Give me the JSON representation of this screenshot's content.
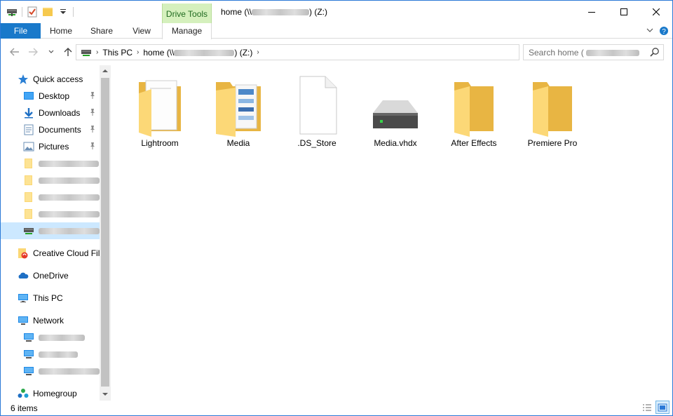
{
  "window": {
    "title": "home (\\\\",
    "title_suffix": ") (Z:)",
    "context_tab_group": "Drive Tools",
    "accent_color": "#1979ca"
  },
  "ribbon": {
    "tabs": [
      {
        "label": "File"
      },
      {
        "label": "Home"
      },
      {
        "label": "Share"
      },
      {
        "label": "View"
      },
      {
        "label": "Manage"
      }
    ]
  },
  "address": {
    "crumbs": [
      {
        "label": "This PC"
      },
      {
        "label": "home (\\\\",
        "suffix": ") (Z:)"
      }
    ]
  },
  "search": {
    "placeholder": "Search home ("
  },
  "nav": {
    "quick_access": "Quick access",
    "pinned": [
      {
        "label": "Desktop",
        "icon": "desktop-icon"
      },
      {
        "label": "Downloads",
        "icon": "downloads-icon"
      },
      {
        "label": "Documents",
        "icon": "documents-icon"
      },
      {
        "label": "Pictures",
        "icon": "pictures-icon"
      }
    ],
    "creative_cloud": "Creative Cloud Fil",
    "onedrive": "OneDrive",
    "this_pc": "This PC",
    "network": "Network",
    "homegroup": "Homegroup"
  },
  "files": [
    {
      "name": "Lightroom",
      "icon": "folder-with-document-icon"
    },
    {
      "name": "Media",
      "icon": "folder-with-pictures-icon"
    },
    {
      "name": ".DS_Store",
      "icon": "blank-file-icon"
    },
    {
      "name": "Media.vhdx",
      "icon": "hard-drive-icon"
    },
    {
      "name": "After Effects",
      "icon": "folder-icon"
    },
    {
      "name": "Premiere Pro",
      "icon": "folder-icon"
    }
  ],
  "status": {
    "item_count": "6 items"
  }
}
